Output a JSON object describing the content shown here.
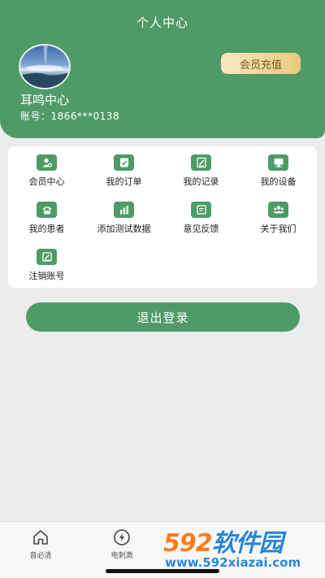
{
  "header": {
    "title": "个人中心"
  },
  "user": {
    "name": "耳鸣中心",
    "account": "账号：1866***0138",
    "recharge_label": "会员充值"
  },
  "menu": [
    {
      "label": "会员中心",
      "icon": "member-icon"
    },
    {
      "label": "我的订单",
      "icon": "order-icon"
    },
    {
      "label": "我的记录",
      "icon": "record-icon"
    },
    {
      "label": "我的设备",
      "icon": "device-icon"
    },
    {
      "label": "我的患者",
      "icon": "patient-icon"
    },
    {
      "label": "添加测试数据",
      "icon": "chart-icon"
    },
    {
      "label": "意见反馈",
      "icon": "feedback-icon"
    },
    {
      "label": "关于我们",
      "icon": "about-icon"
    },
    {
      "label": "注销账号",
      "icon": "cancel-account-icon"
    }
  ],
  "logout_label": "退出登录",
  "tabbar": [
    {
      "label": "音必清",
      "icon": "home-icon"
    },
    {
      "label": "电刺激",
      "icon": "lightning-icon"
    }
  ],
  "watermark": {
    "brand_number": "592",
    "brand_text": "软件园",
    "url": "www.592xiazai.com"
  },
  "colors": {
    "primary": "#4e9b67",
    "recharge_gold": "#e9c97e",
    "background": "#ececec"
  }
}
